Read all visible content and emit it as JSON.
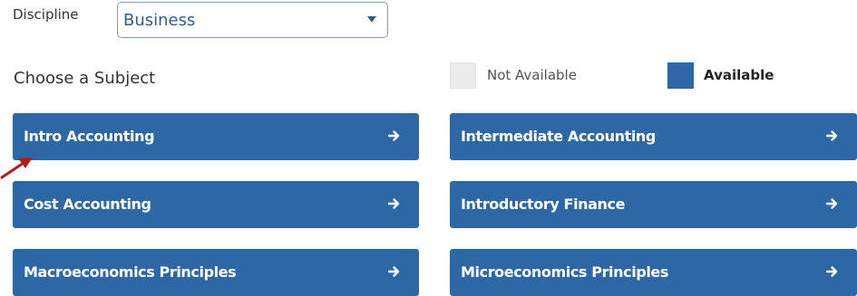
{
  "filter": {
    "label": "Discipline",
    "selected_value": "Business"
  },
  "heading": "Choose a Subject",
  "legend": {
    "not_available_label": "Not Available",
    "available_label": "Available"
  },
  "subjects": [
    {
      "label": "Intro Accounting",
      "icon": "arrow-right-icon"
    },
    {
      "label": "Intermediate Accounting",
      "icon": "arrow-right-icon"
    },
    {
      "label": "Cost Accounting",
      "icon": "arrow-right-icon"
    },
    {
      "label": "Introductory Finance",
      "icon": "arrow-right-icon"
    },
    {
      "label": "Macroeconomics Principles",
      "icon": "arrow-right-icon"
    },
    {
      "label": "Microeconomics Principles",
      "icon": "arrow-right-icon"
    }
  ],
  "colors": {
    "available": "#2d67a6",
    "not_available": "#ececec",
    "annotation_arrow": "#b01e1e"
  }
}
